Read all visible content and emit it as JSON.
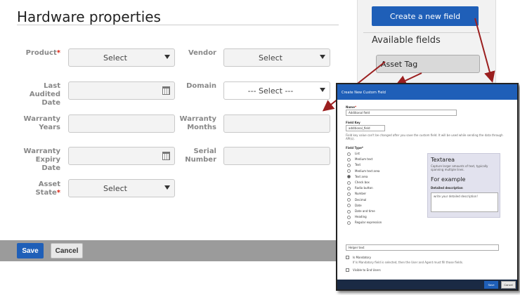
{
  "page": {
    "title": "Hardware properties"
  },
  "fields": {
    "product": {
      "label": "Product",
      "required": "*",
      "value": "Select"
    },
    "vendor": {
      "label": "Vendor",
      "value": "Select"
    },
    "last_audited_date": {
      "label_line1": "Last Audited",
      "label_line2": "Date",
      "value": ""
    },
    "domain": {
      "label": "Domain",
      "value": "--- Select ---"
    },
    "warranty_years": {
      "label": "Warranty Years",
      "value": ""
    },
    "warranty_months": {
      "label": "Warranty Months",
      "value": ""
    },
    "warranty_expiry_date": {
      "label_line1": "Warranty Expiry",
      "label_line2": "Date",
      "value": ""
    },
    "serial_number": {
      "label": "Serial Number",
      "value": ""
    },
    "asset_state": {
      "label": "Asset State",
      "required": "*",
      "value": "Select"
    }
  },
  "footer": {
    "save_label": "Save",
    "cancel_label": "Cancel"
  },
  "sidebar": {
    "create_label": "Create a new field",
    "available_title": "Available fields",
    "items": [
      {
        "label": "Asset Tag"
      }
    ]
  },
  "modal": {
    "title": "Create New Custom Field",
    "name_label": "Name",
    "name_required": "*",
    "name_value": "Additional field",
    "field_key_label": "Field Key",
    "field_key_value": "additional_field",
    "field_key_help": "Field key value can't be changed after you save the custom field. It will be used while sending the data through API(s).",
    "field_type_label": "Field Type*",
    "field_types": [
      {
        "label": "List",
        "selected": false
      },
      {
        "label": "Medium text",
        "selected": false
      },
      {
        "label": "Text",
        "selected": false
      },
      {
        "label": "Medium text area",
        "selected": false
      },
      {
        "label": "Text area",
        "selected": true
      },
      {
        "label": "Check box",
        "selected": false
      },
      {
        "label": "Radio button",
        "selected": false
      },
      {
        "label": "Number",
        "selected": false
      },
      {
        "label": "Decimal",
        "selected": false
      },
      {
        "label": "Date",
        "selected": false
      },
      {
        "label": "Date and time",
        "selected": false
      },
      {
        "label": "Heading",
        "selected": false
      },
      {
        "label": "Regular expression",
        "selected": false
      }
    ],
    "preview": {
      "title": "Textarea",
      "description": "Capture larger amounts of text, typically spanning multiple lines.",
      "example_title": "For example",
      "example_label": "Detailed description",
      "example_placeholder": "write your detailed description!"
    },
    "helper_text_value": "Helper text",
    "mandatory_label": "Is Mandatory",
    "mandatory_help": "If Is Mandatory field is selected, then the User and Agent must fill those fields.",
    "visible_label": "Visible to End Users",
    "save_label": "Save",
    "cancel_label": "Cancel"
  },
  "colors": {
    "primary_blue": "#1f5fb8",
    "arrow_red": "#9b1f1f",
    "footer_gray": "#9b9b9b"
  }
}
